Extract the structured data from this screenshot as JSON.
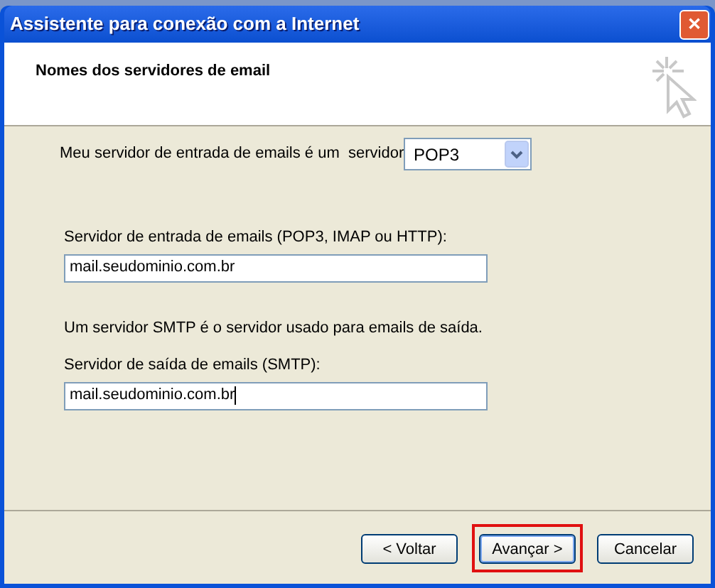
{
  "window": {
    "title": "Assistente para conexão com a Internet",
    "close": "✕"
  },
  "header": {
    "title": "Nomes dos servidores de email"
  },
  "server_type": {
    "label": "Meu servidor de entrada de emails é um  servidor",
    "value": "POP3"
  },
  "incoming": {
    "label": "Servidor de entrada de emails (POP3, IMAP ou HTTP):",
    "value": "mail.seudominio.com.br"
  },
  "smtp_note": "Um servidor SMTP é o servidor usado para emails de saída.",
  "outgoing": {
    "label": "Servidor de saída de emails (SMTP):",
    "value": "mail.seudominio.com.br",
    "focused": true
  },
  "buttons": [
    {
      "label": "< Voltar",
      "highlighted": false
    },
    {
      "label": "Avançar >",
      "highlighted": true
    },
    {
      "label": "Cancelar",
      "highlighted": false
    }
  ]
}
